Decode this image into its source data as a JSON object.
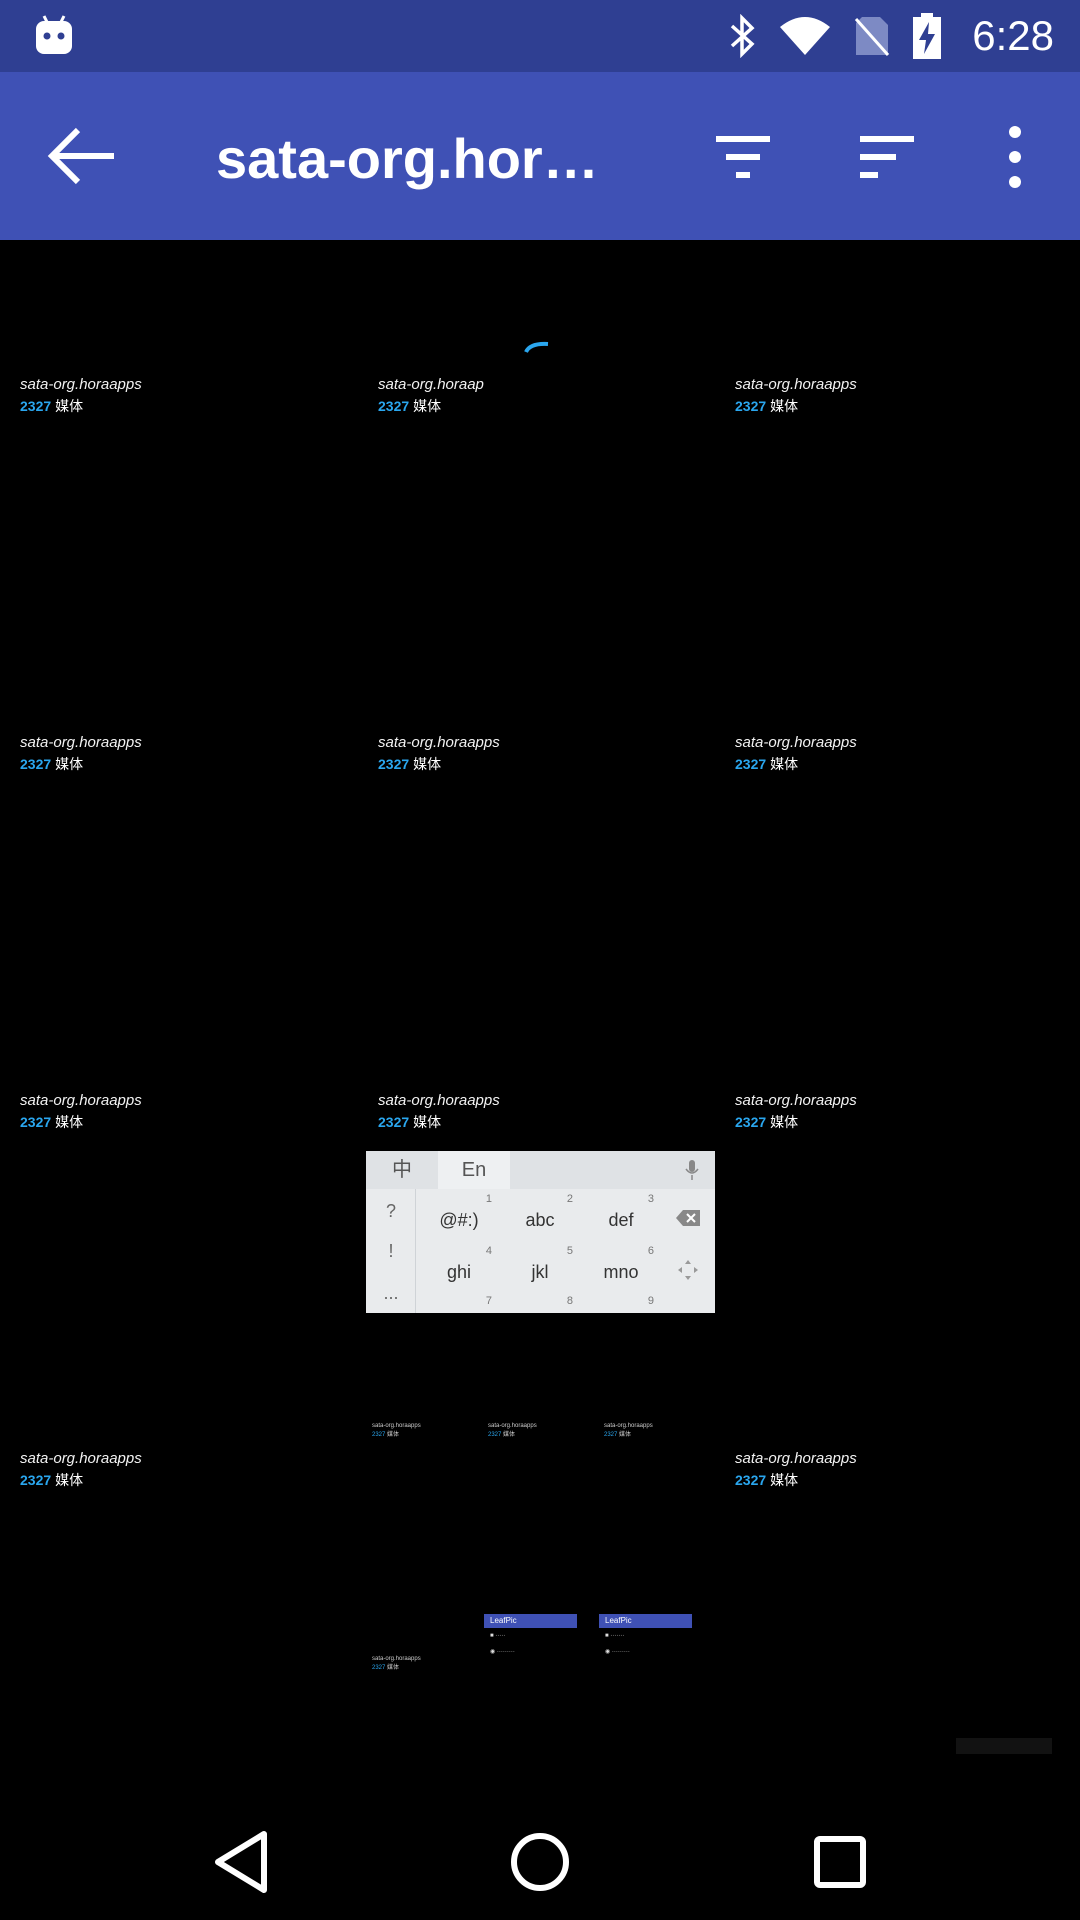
{
  "status_bar": {
    "time": "6:28",
    "icons": [
      "android-robot-icon",
      "bluetooth-icon",
      "wifi-icon",
      "no-sim-icon",
      "battery-charging-icon"
    ]
  },
  "toolbar": {
    "title": "sata-org.hora…",
    "icons": [
      "back-arrow-icon",
      "filter-icon",
      "sort-icon",
      "more-vert-icon"
    ]
  },
  "grid": {
    "items": [
      {
        "name": "sata-org.horaapps",
        "count": "2327",
        "label": "媒体"
      },
      {
        "name": "sata-org.horaap",
        "count": "2327",
        "label": "媒体"
      },
      {
        "name": "sata-org.horaapps",
        "count": "2327",
        "label": "媒体"
      },
      {
        "name": "sata-org.horaapps",
        "count": "2327",
        "label": "媒体"
      },
      {
        "name": "sata-org.horaapps",
        "count": "2327",
        "label": "媒体"
      },
      {
        "name": "sata-org.horaapps",
        "count": "2327",
        "label": "媒体"
      },
      {
        "name": "sata-org.horaapps",
        "count": "2327",
        "label": "媒体"
      },
      {
        "name": "sata-org.horaapps",
        "count": "2327",
        "label": "媒体"
      },
      {
        "name": "sata-org.horaapps",
        "count": "2327",
        "label": "媒体"
      },
      {
        "name": "sata-org.horaapps",
        "count": "2327",
        "label": "媒体"
      },
      {
        "name": "sata-org.horaapps",
        "count": "2327",
        "label": "媒体"
      }
    ]
  },
  "keyboard": {
    "tab_zh": "中",
    "tab_en": "En",
    "left_keys": [
      "?",
      "!",
      "..."
    ],
    "keys": [
      {
        "label": "@#:)",
        "num": "1"
      },
      {
        "label": "abc",
        "num": "2"
      },
      {
        "label": "def",
        "num": "3"
      },
      {
        "label": "ghi",
        "num": "4"
      },
      {
        "label": "jkl",
        "num": "5"
      },
      {
        "label": "mno",
        "num": "6"
      },
      {
        "label": "",
        "num": "7"
      },
      {
        "label": "",
        "num": "8"
      },
      {
        "label": "",
        "num": "9"
      }
    ]
  },
  "thumbnails": {
    "small_name": "sata-org.horaapps",
    "small_count": "2327",
    "small_label": "媒体",
    "app_title": "LeafPic"
  },
  "colors": {
    "status_bar": "#2f3f92",
    "toolbar": "#3f51b5",
    "accent": "#2aa6ee",
    "background": "#000000"
  }
}
